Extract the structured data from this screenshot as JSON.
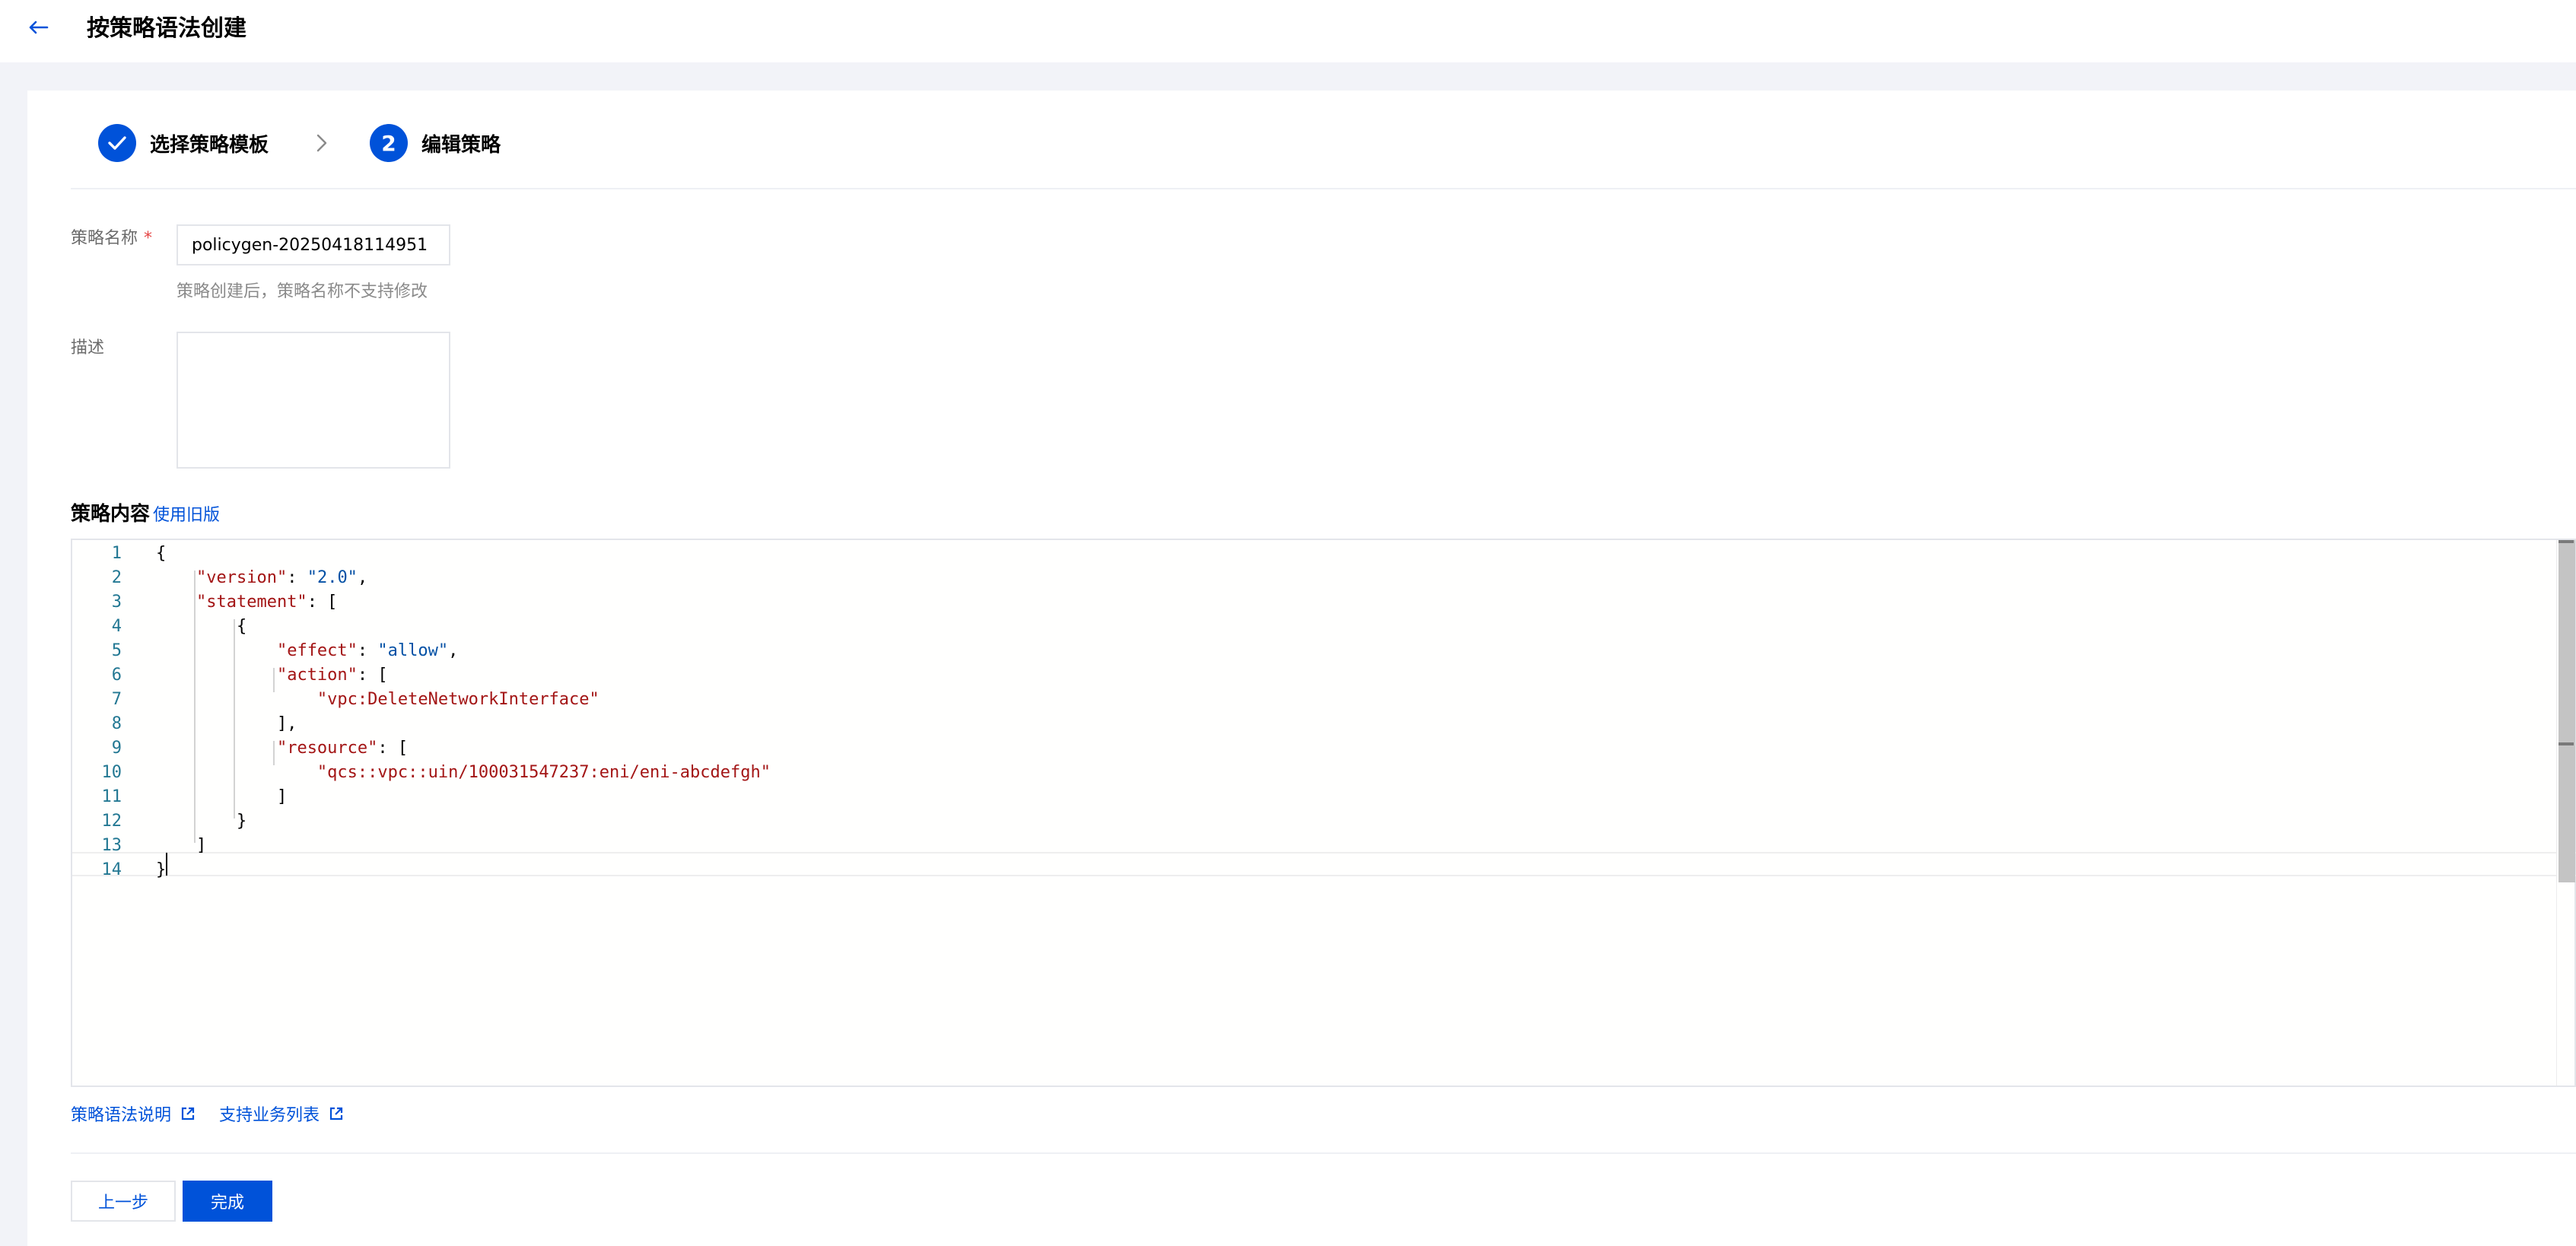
{
  "header": {
    "title": "按策略语法创建",
    "back_icon": "arrow-left-icon"
  },
  "steps": [
    {
      "index": "1",
      "label": "选择策略模板",
      "status": "done",
      "icon": "check-icon"
    },
    {
      "index": "2",
      "label": "编辑策略",
      "status": "current"
    }
  ],
  "form": {
    "name_label": "策略名称",
    "name_required_mark": "*",
    "name_value": "policygen-20250418114951",
    "name_help": "策略创建后，策略名称不支持修改",
    "desc_label": "描述",
    "desc_value": ""
  },
  "content": {
    "title": "策略内容",
    "old_version_link": "使用旧版"
  },
  "editor": {
    "line_numbers": [
      "1",
      "2",
      "3",
      "4",
      "5",
      "6",
      "7",
      "8",
      "9",
      "10",
      "11",
      "12",
      "13",
      "14"
    ],
    "lines": [
      {
        "tokens": [
          {
            "t": "{",
            "c": ""
          }
        ]
      },
      {
        "tokens": [
          {
            "t": "    ",
            "c": ""
          },
          {
            "t": "\"version\"",
            "c": "key"
          },
          {
            "t": ": ",
            "c": ""
          },
          {
            "t": "\"2.0\"",
            "c": "val"
          },
          {
            "t": ",",
            "c": ""
          }
        ]
      },
      {
        "tokens": [
          {
            "t": "    ",
            "c": ""
          },
          {
            "t": "\"statement\"",
            "c": "key"
          },
          {
            "t": ": [",
            "c": ""
          }
        ]
      },
      {
        "tokens": [
          {
            "t": "        {",
            "c": ""
          }
        ]
      },
      {
        "tokens": [
          {
            "t": "            ",
            "c": ""
          },
          {
            "t": "\"effect\"",
            "c": "key"
          },
          {
            "t": ": ",
            "c": ""
          },
          {
            "t": "\"allow\"",
            "c": "val"
          },
          {
            "t": ",",
            "c": ""
          }
        ]
      },
      {
        "tokens": [
          {
            "t": "            ",
            "c": ""
          },
          {
            "t": "\"action\"",
            "c": "key"
          },
          {
            "t": ": [",
            "c": ""
          }
        ]
      },
      {
        "tokens": [
          {
            "t": "                ",
            "c": ""
          },
          {
            "t": "\"vpc:DeleteNetworkInterface\"",
            "c": "str"
          }
        ]
      },
      {
        "tokens": [
          {
            "t": "            ],",
            "c": ""
          }
        ]
      },
      {
        "tokens": [
          {
            "t": "            ",
            "c": ""
          },
          {
            "t": "\"resource\"",
            "c": "key"
          },
          {
            "t": ": [",
            "c": ""
          }
        ]
      },
      {
        "tokens": [
          {
            "t": "                ",
            "c": ""
          },
          {
            "t": "\"qcs::vpc::uin/100031547237:eni/eni-abcdefgh\"",
            "c": "str"
          }
        ]
      },
      {
        "tokens": [
          {
            "t": "            ]",
            "c": ""
          }
        ]
      },
      {
        "tokens": [
          {
            "t": "        }",
            "c": ""
          }
        ]
      },
      {
        "tokens": [
          {
            "t": "    ]",
            "c": ""
          }
        ]
      },
      {
        "tokens": [
          {
            "t": "}",
            "c": ""
          }
        ]
      }
    ],
    "active_line": 14
  },
  "links": {
    "syntax_doc": "策略语法说明",
    "supported_services": "支持业务列表",
    "icon": "external-link-icon"
  },
  "buttons": {
    "prev": "上一步",
    "finish": "完成"
  },
  "colors": {
    "primary": "#0052d9",
    "key": "#a31515",
    "value": "#0451a5",
    "line_number": "#237893"
  }
}
